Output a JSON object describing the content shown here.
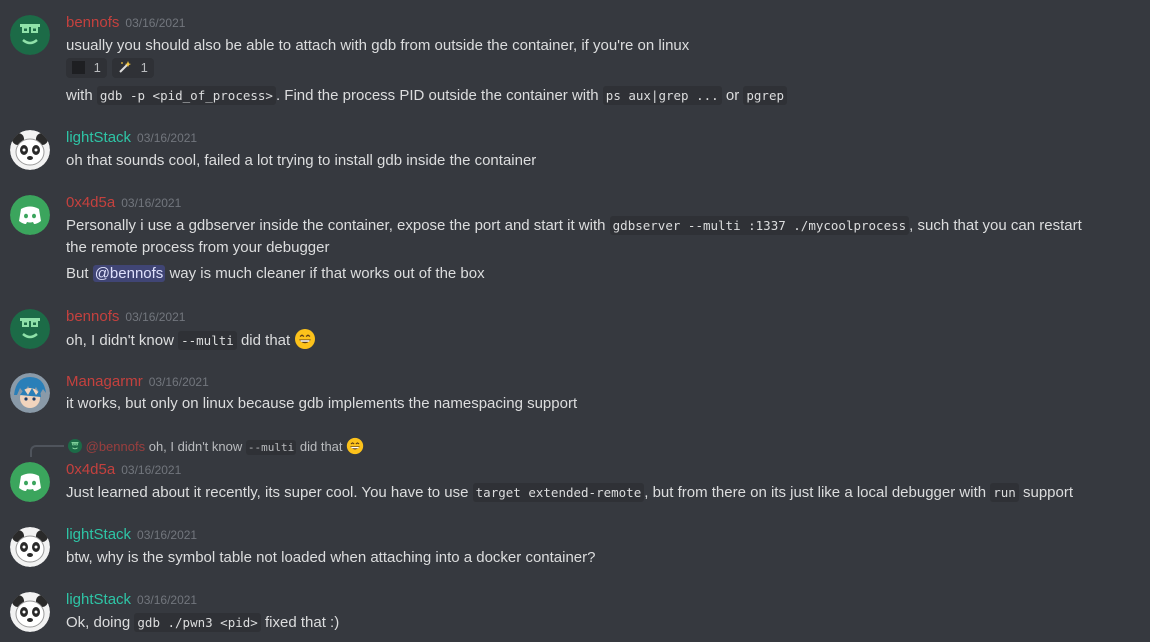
{
  "colors": {
    "bennofs": "#c4413e",
    "lightStack": "#2ec5a6",
    "0x4d5a": "#c4413e",
    "Managarmr": "#c4413e"
  },
  "messages": [
    {
      "author": "bennofs",
      "time": "03/16/2021",
      "avatar": "sunglasses-avatar",
      "line1": "usually you should also be able to attach with gdb from outside the container, if you're on linux",
      "reactions": [
        "1",
        "1"
      ],
      "line2_a": "with",
      "line2_code1": "gdb -p <pid_of_process>",
      "line2_b": ". Find the process PID outside the container with",
      "line2_code2": "ps aux|grep ...",
      "line2_c": "or",
      "line2_code3": "pgrep"
    },
    {
      "author": "lightStack",
      "time": "03/16/2021",
      "avatar": "panda-avatar",
      "line1": "oh that sounds cool, failed a lot trying to install gdb inside the container"
    },
    {
      "author": "0x4d5a",
      "time": "03/16/2021",
      "avatar": "discord-avatar",
      "line1_a": "Personally i use a gdbserver inside the container, expose the port and start it with",
      "line1_code": "gdbserver --multi :1337 ./mycoolprocess",
      "line1_b": ", such that you can restart",
      "line2": "the remote process from your debugger",
      "line3_a": "But",
      "line3_mention": "@bennofs",
      "line3_b": "way is much cleaner if that works out of the box"
    },
    {
      "author": "bennofs",
      "time": "03/16/2021",
      "avatar": "sunglasses-avatar",
      "line1_a": "oh, I didn't know",
      "line1_code": "--multi",
      "line1_b": "did that"
    },
    {
      "author": "Managarmr",
      "time": "03/16/2021",
      "avatar": "anime-avatar",
      "line1": "it works, but only on linux because gdb implements the namespacing support"
    },
    {
      "author": "0x4d5a",
      "time": "03/16/2021",
      "avatar": "discord-avatar",
      "reply_mention": "@bennofs",
      "reply_a": "oh, I didn't know",
      "reply_code": "--multi",
      "reply_b": "did that",
      "line1_a": "Just learned about it recently, its super cool. You have to use",
      "line1_code1": "target extended-remote",
      "line1_b": ", but from there on its just like a local debugger with",
      "line1_code2": "run",
      "line1_c": "support"
    },
    {
      "author": "lightStack",
      "time": "03/16/2021",
      "avatar": "panda-avatar",
      "line1": "btw, why is the symbol table not loaded when attaching into a docker container?"
    },
    {
      "author": "lightStack",
      "time": "03/16/2021",
      "avatar": "panda-avatar",
      "line1_a": "Ok, doing",
      "line1_code": "gdb ./pwn3 <pid>",
      "line1_b": "fixed that :)"
    }
  ]
}
